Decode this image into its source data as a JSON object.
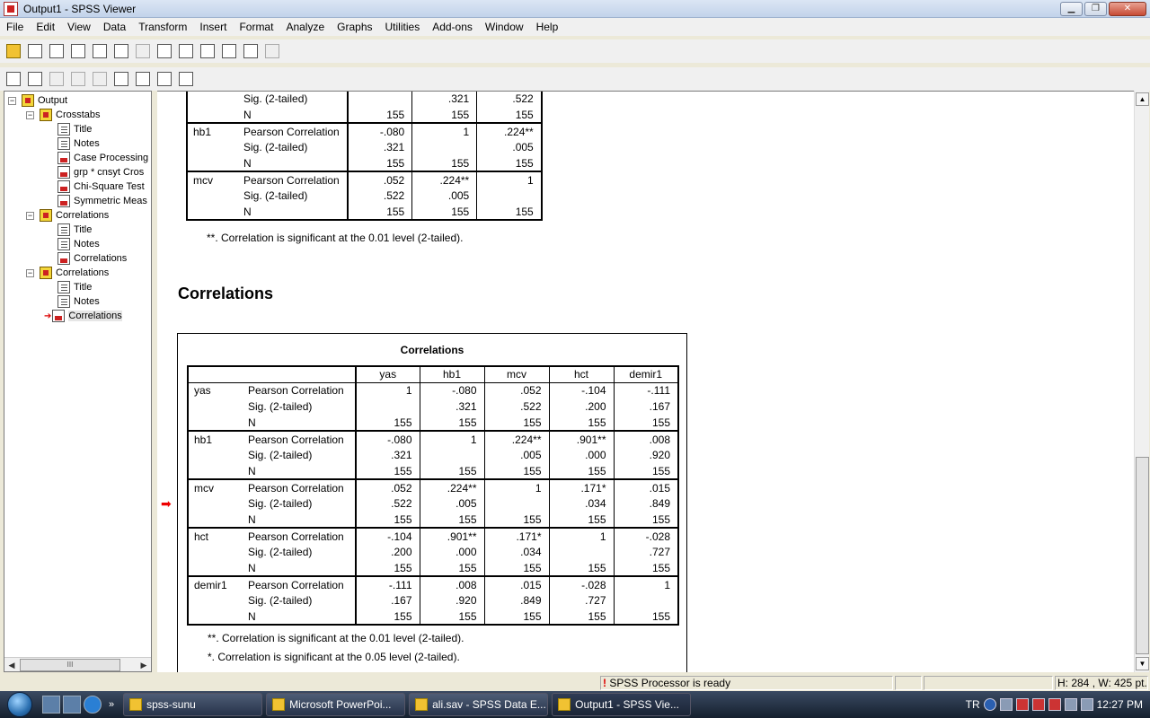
{
  "window": {
    "title": "Output1 - SPSS Viewer"
  },
  "menu": [
    "File",
    "Edit",
    "View",
    "Data",
    "Transform",
    "Insert",
    "Format",
    "Analyze",
    "Graphs",
    "Utilities",
    "Add-ons",
    "Window",
    "Help"
  ],
  "tree": [
    {
      "level": 0,
      "type": "book",
      "label": "Output",
      "expander": "−"
    },
    {
      "level": 1,
      "type": "book",
      "label": "Crosstabs",
      "expander": "−"
    },
    {
      "level": 2,
      "type": "note",
      "label": "Title"
    },
    {
      "level": 2,
      "type": "note",
      "label": "Notes"
    },
    {
      "level": 2,
      "type": "tab",
      "label": "Case Processing"
    },
    {
      "level": 2,
      "type": "tab",
      "label": "grp * cnsyt Cros"
    },
    {
      "level": 2,
      "type": "tab",
      "label": "Chi-Square Test"
    },
    {
      "level": 2,
      "type": "tab",
      "label": "Symmetric Meas"
    },
    {
      "level": 1,
      "type": "book",
      "label": "Correlations",
      "expander": "−"
    },
    {
      "level": 2,
      "type": "note",
      "label": "Title"
    },
    {
      "level": 2,
      "type": "note",
      "label": "Notes"
    },
    {
      "level": 2,
      "type": "tab",
      "label": "Correlations"
    },
    {
      "level": 1,
      "type": "book",
      "label": "Correlations",
      "expander": "−"
    },
    {
      "level": 2,
      "type": "note",
      "label": "Title"
    },
    {
      "level": 2,
      "type": "note",
      "label": "Notes"
    },
    {
      "level": 2,
      "type": "tab",
      "label": "Correlations",
      "selected": true
    }
  ],
  "table1": {
    "rows": [
      {
        "var": "",
        "stat": "Sig. (2-tailed)",
        "vals": [
          "",
          ".321",
          ".522"
        ]
      },
      {
        "var": "",
        "stat": "N",
        "vals": [
          "155",
          "155",
          "155"
        ]
      },
      {
        "var": "hb1",
        "stat": "Pearson Correlation",
        "vals": [
          "-.080",
          "1",
          ".224**"
        ]
      },
      {
        "var": "",
        "stat": "Sig. (2-tailed)",
        "vals": [
          ".321",
          "",
          ".005"
        ]
      },
      {
        "var": "",
        "stat": "N",
        "vals": [
          "155",
          "155",
          "155"
        ]
      },
      {
        "var": "mcv",
        "stat": "Pearson Correlation",
        "vals": [
          ".052",
          ".224**",
          "1"
        ]
      },
      {
        "var": "",
        "stat": "Sig. (2-tailed)",
        "vals": [
          ".522",
          ".005",
          ""
        ]
      },
      {
        "var": "",
        "stat": "N",
        "vals": [
          "155",
          "155",
          "155"
        ]
      }
    ],
    "footnote": "**. Correlation is significant at the 0.01 level (2-tailed)."
  },
  "heading": "Correlations",
  "table2": {
    "title": "Correlations",
    "columns": [
      "yas",
      "hb1",
      "mcv",
      "hct",
      "demir1"
    ],
    "groups": [
      {
        "var": "yas",
        "rows": [
          {
            "stat": "Pearson Correlation",
            "vals": [
              "1",
              "-.080",
              ".052",
              "-.104",
              "-.111"
            ]
          },
          {
            "stat": "Sig. (2-tailed)",
            "vals": [
              "",
              ".321",
              ".522",
              ".200",
              ".167"
            ]
          },
          {
            "stat": "N",
            "vals": [
              "155",
              "155",
              "155",
              "155",
              "155"
            ]
          }
        ]
      },
      {
        "var": "hb1",
        "rows": [
          {
            "stat": "Pearson Correlation",
            "vals": [
              "-.080",
              "1",
              ".224**",
              ".901**",
              ".008"
            ]
          },
          {
            "stat": "Sig. (2-tailed)",
            "vals": [
              ".321",
              "",
              ".005",
              ".000",
              ".920"
            ]
          },
          {
            "stat": "N",
            "vals": [
              "155",
              "155",
              "155",
              "155",
              "155"
            ]
          }
        ]
      },
      {
        "var": "mcv",
        "rows": [
          {
            "stat": "Pearson Correlation",
            "vals": [
              ".052",
              ".224**",
              "1",
              ".171*",
              ".015"
            ]
          },
          {
            "stat": "Sig. (2-tailed)",
            "vals": [
              ".522",
              ".005",
              "",
              ".034",
              ".849"
            ]
          },
          {
            "stat": "N",
            "vals": [
              "155",
              "155",
              "155",
              "155",
              "155"
            ]
          }
        ]
      },
      {
        "var": "hct",
        "rows": [
          {
            "stat": "Pearson Correlation",
            "vals": [
              "-.104",
              ".901**",
              ".171*",
              "1",
              "-.028"
            ]
          },
          {
            "stat": "Sig. (2-tailed)",
            "vals": [
              ".200",
              ".000",
              ".034",
              "",
              ".727"
            ]
          },
          {
            "stat": "N",
            "vals": [
              "155",
              "155",
              "155",
              "155",
              "155"
            ]
          }
        ]
      },
      {
        "var": "demir1",
        "rows": [
          {
            "stat": "Pearson Correlation",
            "vals": [
              "-.111",
              ".008",
              ".015",
              "-.028",
              "1"
            ]
          },
          {
            "stat": "Sig. (2-tailed)",
            "vals": [
              ".167",
              ".920",
              ".849",
              ".727",
              ""
            ]
          },
          {
            "stat": "N",
            "vals": [
              "155",
              "155",
              "155",
              "155",
              "155"
            ]
          }
        ]
      }
    ],
    "footnotes": [
      "**. Correlation is significant at the 0.01 level (2-tailed).",
      "*. Correlation is significant at the 0.05 level (2-tailed)."
    ]
  },
  "status": {
    "processor": "SPSS Processor  is ready",
    "dims": "H: 284 , W: 425  pt."
  },
  "taskbar": {
    "tasks": [
      "spss-sunu",
      "Microsoft PowerPoi...",
      "ali.sav - SPSS Data E...",
      "Output1 - SPSS Vie..."
    ],
    "lang": "TR",
    "clock": "12:27 PM"
  }
}
